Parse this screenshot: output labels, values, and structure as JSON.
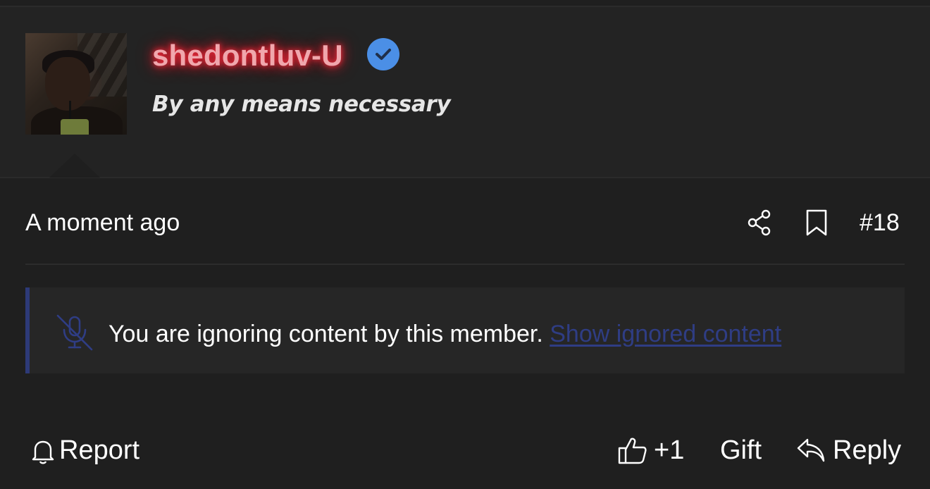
{
  "post": {
    "username": "shedontluv-U",
    "tagline": "By any means necessary",
    "timestamp": "A moment ago",
    "post_number": "#18",
    "verified_icon": "verified-check-icon",
    "name_glow_color": "#ff2b3d",
    "verified_color": "#4b8fe6"
  },
  "notice": {
    "text": "You are ignoring content by this member.",
    "link_label": "Show ignored content",
    "icon": "muted-microphone-icon",
    "accent_color": "#2d3a78"
  },
  "actions": {
    "report_label": "Report",
    "like_label": "+1",
    "gift_label": "Gift",
    "reply_label": "Reply"
  },
  "icons": {
    "share": "share-icon",
    "bookmark": "bookmark-icon",
    "report": "bell-icon",
    "like": "thumbs-up-icon",
    "reply": "reply-arrow-icon"
  }
}
